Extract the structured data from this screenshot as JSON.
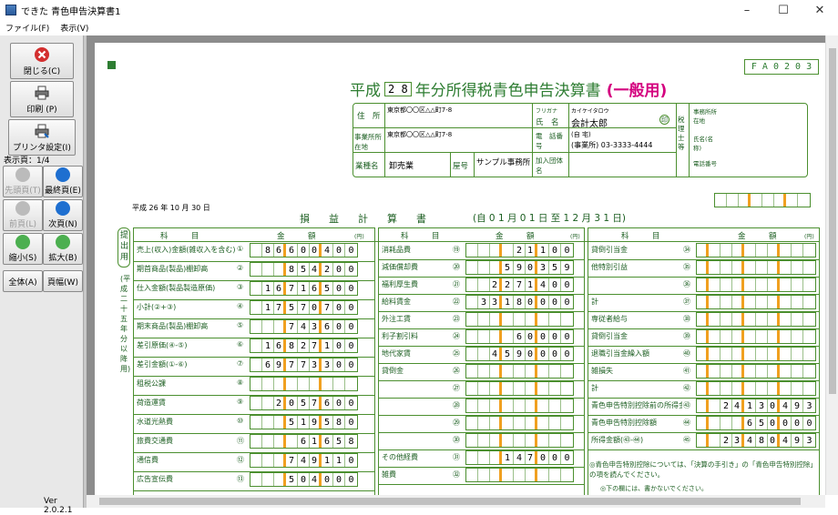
{
  "window": {
    "title": "できた 青色申告決算書1",
    "minimize": "–",
    "maximize": "☐",
    "close": "✕"
  },
  "menu": [
    "ファイル(F)",
    "表示(V)"
  ],
  "toolbar": {
    "close": "閉じる(C)",
    "print": "印刷 (P)",
    "printer_setup": "プリンタ設定(I)",
    "page_display": "表示頁：1/4",
    "first_page": "先頭頁(T)",
    "last_page": "最終頁(E)",
    "prev_page": "前頁(L)",
    "next_page": "次頁(N)",
    "zoom_out": "縮小(S)",
    "zoom_in": "拡大(B)",
    "fit_page": "全体(A)",
    "fit_width": "頁幅(W)",
    "version": "Ver 2.0.2.1"
  },
  "form": {
    "form_code": "F A 0 2 0 3",
    "era": "平成",
    "year": "2 8",
    "title_suffix": "年分所得税青色申告決算書",
    "title_type": "(一般用)",
    "address_label": "住　所",
    "address": "東京都〇〇区△△町7-8",
    "furigana_label": "フリガナ",
    "furigana": "カイケイタロウ",
    "name_label": "氏　名",
    "name": "会計太郎",
    "seal": "印",
    "office_label": "事業所所在地",
    "office_address": "東京都〇〇区△△町7-8",
    "phone_label": "電　話番　号",
    "phone_home": "(自 宅)",
    "phone_office": "(事業所) 03-3333-4444",
    "business_label": "業種名",
    "business": "卸売業",
    "shop_label": "屋号",
    "shop": "サンプル事務所",
    "union_label": "加入団体名",
    "tax_acct_label": "税理士等",
    "tax_acct_addr": "事務所所在地",
    "tax_acct_name": "氏名(名称)",
    "tax_acct_phone": "電話番号",
    "date": "平成 26 年 10 月 30 日",
    "pl_title": "損　益　計　算　書",
    "period": "(自 0 1 月 0 1 日 至 1 2 月 3 1 日)",
    "side_label": "提出用",
    "side_note": "(平成二十五年分以降用)",
    "col_item": "科　　　目",
    "col_amount": "金　　　額",
    "yen": "(円)"
  },
  "left_rows": [
    {
      "label": "売上(収入)金額(雑収入を含む)",
      "no": "①",
      "value": "86600400"
    },
    {
      "label": "期首商品(製品)棚卸高",
      "no": "②",
      "value": "854200"
    },
    {
      "label": "仕入金額(製品製造原価)",
      "no": "③",
      "value": "16716500"
    },
    {
      "label": "小計(②+③)",
      "no": "④",
      "value": "17570700"
    },
    {
      "label": "期末商品(製品)棚卸高",
      "no": "⑤",
      "value": "743600"
    },
    {
      "label": "差引原価(④-⑤)",
      "no": "⑥",
      "value": "16827100"
    },
    {
      "label": "差引金額(①-⑥)",
      "no": "⑦",
      "value": "69773300"
    },
    {
      "label": "租税公課",
      "no": "⑧",
      "value": ""
    },
    {
      "label": "荷造運賃",
      "no": "⑨",
      "value": "2057600"
    },
    {
      "label": "水道光熱費",
      "no": "⑩",
      "value": "519580"
    },
    {
      "label": "旅費交通費",
      "no": "⑪",
      "value": "61658"
    },
    {
      "label": "通信費",
      "no": "⑫",
      "value": "749110"
    },
    {
      "label": "広告宣伝費",
      "no": "⑬",
      "value": "504000"
    }
  ],
  "mid_rows": [
    {
      "label": "消耗品費",
      "no": "⑲",
      "value": "21100"
    },
    {
      "label": "減価償却費",
      "no": "⑳",
      "value": "590359"
    },
    {
      "label": "福利厚生費",
      "no": "㉑",
      "value": "2271400"
    },
    {
      "label": "給料賃金",
      "no": "㉒",
      "value": "33180000"
    },
    {
      "label": "外注工賃",
      "no": "㉓",
      "value": ""
    },
    {
      "label": "利子割引料",
      "no": "㉔",
      "value": "60000"
    },
    {
      "label": "地代家賃",
      "no": "㉕",
      "value": "4590000"
    },
    {
      "label": "貸倒金",
      "no": "㉖",
      "value": ""
    },
    {
      "label": "",
      "no": "㉗",
      "value": ""
    },
    {
      "label": "",
      "no": "㉘",
      "value": ""
    },
    {
      "label": "",
      "no": "㉙",
      "value": ""
    },
    {
      "label": "",
      "no": "㉚",
      "value": ""
    },
    {
      "label": "その他経費",
      "no": "㉛",
      "value": "147000"
    },
    {
      "label": "雑費",
      "no": "㉜",
      "value": ""
    }
  ],
  "right_rows": [
    {
      "label": "貸倒引当金",
      "no": "㉞",
      "value": ""
    },
    {
      "label": "他特別引益",
      "no": "㉟",
      "value": ""
    },
    {
      "label": "",
      "no": "㊱",
      "value": ""
    },
    {
      "label": "計",
      "no": "㊲",
      "value": ""
    },
    {
      "label": "専従者給与",
      "no": "㊳",
      "value": ""
    },
    {
      "label": "貸倒引当金",
      "no": "㊴",
      "value": ""
    },
    {
      "label": "退職引当金繰入額",
      "no": "㊵",
      "value": ""
    },
    {
      "label": "雑損失",
      "no": "㊶",
      "value": ""
    },
    {
      "label": "計",
      "no": "㊷",
      "value": ""
    },
    {
      "label": "青色申告特別控除前の所得金額",
      "no": "㊸",
      "value": "24130493"
    },
    {
      "label": "青色申告特別控除額",
      "no": "㊹",
      "value": "650000"
    },
    {
      "label": "所得金額(㊸-㊹)",
      "no": "㊺",
      "value": "23480493"
    }
  ],
  "notes": {
    "note1": "◎青色申告特別控除については、「決算の手引き」の「青色申告特別控除」の項を読んでください。",
    "note2": "◎下の欄には、書かないでください。"
  }
}
